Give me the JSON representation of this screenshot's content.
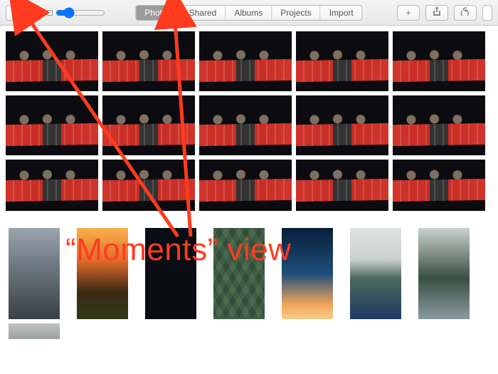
{
  "toolbar": {
    "tabs": [
      {
        "label": "Photos",
        "active": true
      },
      {
        "label": "Shared",
        "active": false
      },
      {
        "label": "Albums",
        "active": false
      },
      {
        "label": "Projects",
        "active": false
      },
      {
        "label": "Import",
        "active": false
      }
    ],
    "add_label": "+"
  },
  "annotation": {
    "text": "“Moments” view",
    "color": "#ff3b1f"
  }
}
